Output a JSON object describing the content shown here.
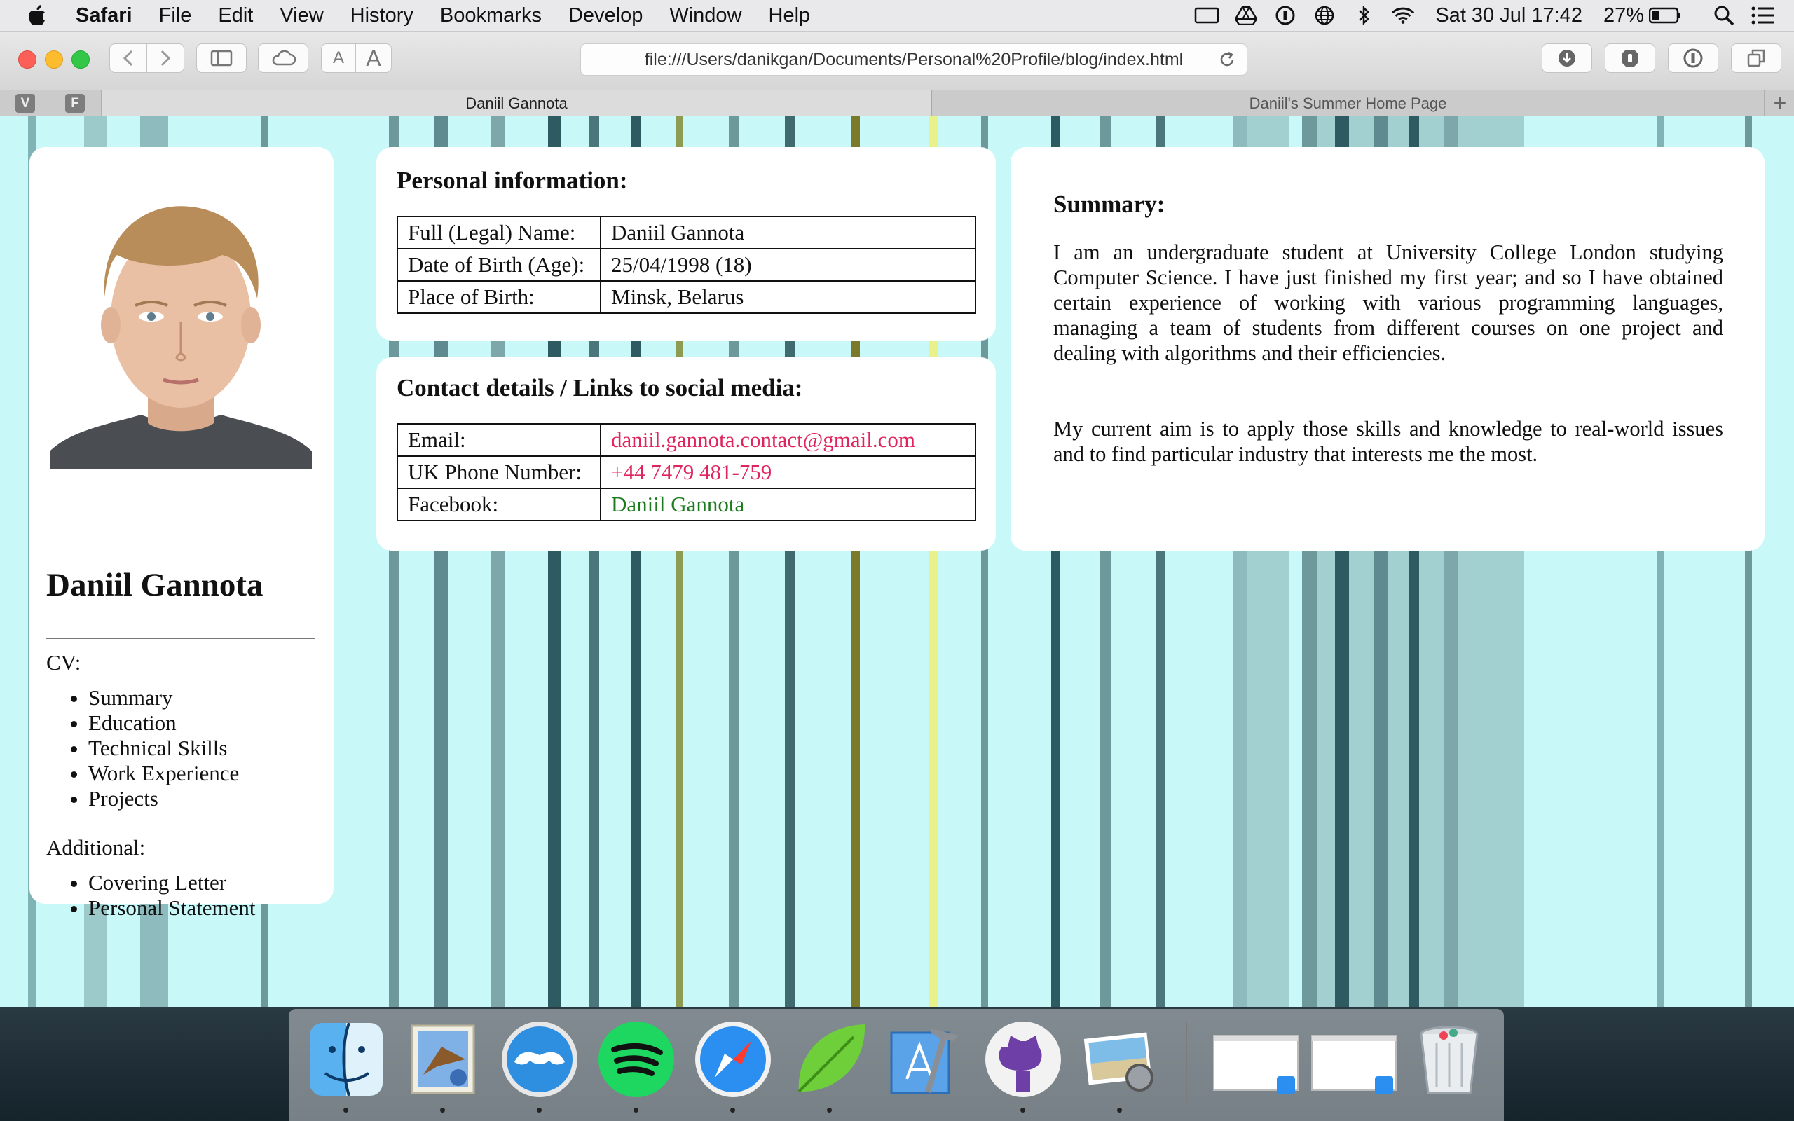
{
  "menubar": {
    "items": [
      "Safari",
      "File",
      "Edit",
      "View",
      "History",
      "Bookmarks",
      "Develop",
      "Window",
      "Help"
    ],
    "clock": "Sat 30 Jul  17:42",
    "battery_pct": "27%",
    "status_icons": [
      "display-icon",
      "google-drive-icon",
      "onepassword-icon",
      "globe-icon",
      "bluetooth-icon",
      "wifi-icon"
    ]
  },
  "browser": {
    "url": "file:///Users/danikgan/Documents/Personal%20Profile/blog/index.html",
    "pinned_tabs": [
      "V",
      "F"
    ],
    "tabs": [
      {
        "label": "Daniil Gannota",
        "active": true
      },
      {
        "label": "Daniil's Summer Home Page",
        "active": false
      }
    ],
    "toolbar_text": {
      "font_small": "A",
      "font_large": "A"
    }
  },
  "profile": {
    "name": "Daniil Gannota",
    "cv_label": "CV:",
    "cv_links": [
      "Summary",
      "Education",
      "Technical Skills",
      "Work Experience",
      "Projects"
    ],
    "additional_label": "Additional:",
    "additional_links": [
      "Covering Letter",
      "Personal Statement"
    ]
  },
  "personal": {
    "title": "Personal information:",
    "rows": [
      {
        "key": "Full (Legal) Name:",
        "value": "Daniil Gannota"
      },
      {
        "key": "Date of Birth (Age):",
        "value": "25/04/1998 (18)"
      },
      {
        "key": "Place of Birth:",
        "value": "Minsk, Belarus"
      }
    ]
  },
  "contact": {
    "title": "Contact details / Links to social media:",
    "rows": [
      {
        "key": "Email:",
        "value": "daniil.gannota.contact@gmail.com"
      },
      {
        "key": "UK Phone Number:",
        "value": "+44 7479 481-759"
      },
      {
        "key": "Facebook:",
        "value": "Daniil Gannota"
      }
    ]
  },
  "summary": {
    "title": "Summary:",
    "paragraph1": "I am an undergraduate student at University College London studying Computer Science. I have just finished my first year; and so I have obtained certain experience of working with various programming languages, managing a team of students from different courses on one project and dealing with algorithms and their efficiencies.",
    "paragraph2": "My current aim is to apply those skills and knowledge to real-world issues and to find particular industry that interests me the most."
  },
  "dock": {
    "apps": [
      "Finder",
      "Mail",
      "Tweetbot",
      "Spotify",
      "Safari",
      "Coda",
      "Xcode",
      "GitHub Desktop",
      "Preview",
      "Safari window",
      "Safari window",
      "Trash"
    ]
  },
  "colors": {
    "link_red": "#e0245e",
    "link_green": "#1d7a1d",
    "page_background": "#c8f8f8"
  }
}
